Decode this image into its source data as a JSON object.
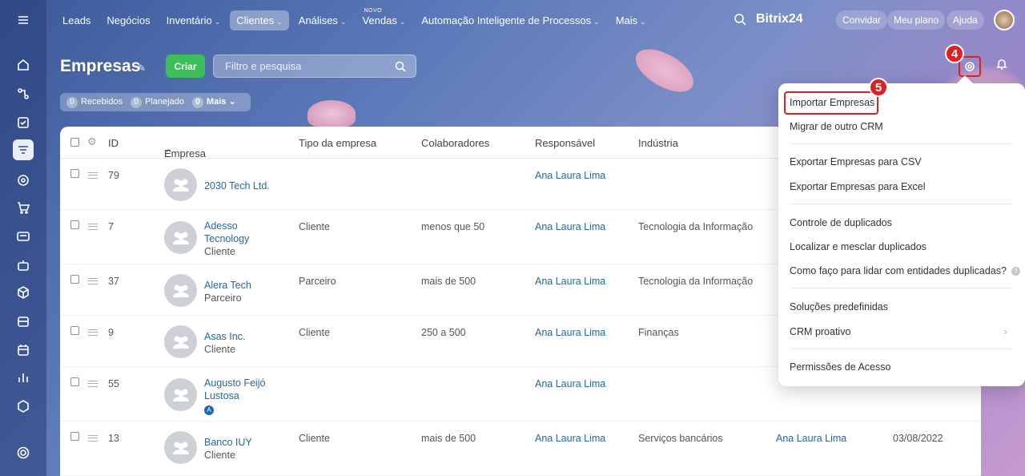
{
  "topnav": {
    "items": [
      "Leads",
      "Negócios",
      "Inventário",
      "Clientes",
      "Análises",
      "Vendas",
      "Automação Inteligente de Processos",
      "Mais"
    ],
    "new_badge": "NOVO",
    "brand": "Bitrix24",
    "invite": "Convidar",
    "plan": "Meu plano",
    "help": "Ajuda"
  },
  "page": {
    "title": "Empresas",
    "create_label": "Criar",
    "filter_placeholder": "Filtro e pesquisa"
  },
  "counters": {
    "received_count": "0",
    "received_label": "Recebidos",
    "planned_count": "0",
    "planned_label": "Planejado",
    "more_count": "0",
    "more_label": "Mais"
  },
  "steps": {
    "gear_step": "4",
    "import_step": "5"
  },
  "table": {
    "headers": [
      "ID",
      "Empresa",
      "Tipo da empresa",
      "Colaboradores",
      "Responsável",
      "Indústria"
    ],
    "rows": [
      {
        "id": "79",
        "name": "2030 Tech Ltd.",
        "subtype": "",
        "type": "",
        "staff": "",
        "owner": "Ana Laura Lima",
        "industry": ""
      },
      {
        "id": "7",
        "name": "Adesso Tecnology",
        "subtype": "Cliente",
        "type": "Cliente",
        "staff": "menos que 50",
        "owner": "Ana Laura Lima",
        "industry": "Tecnologia da Informação"
      },
      {
        "id": "37",
        "name": "Alera Tech",
        "subtype": "Parceiro",
        "type": "Parceiro",
        "staff": "mais de 500",
        "owner": "Ana Laura Lima",
        "industry": "Tecnologia da Informação"
      },
      {
        "id": "9",
        "name": "Asas Inc.",
        "subtype": "Cliente",
        "type": "Cliente",
        "staff": "250 a 500",
        "owner": "Ana Laura Lima",
        "industry": "Finanças"
      },
      {
        "id": "55",
        "name": "Augusto Feijó Lustosa",
        "subtype": "",
        "type": "",
        "staff": "",
        "owner": "Ana Laura Lima",
        "industry": ""
      },
      {
        "id": "13",
        "name": "Banco IUY",
        "subtype": "Cliente",
        "type": "Cliente",
        "staff": "mais de 500",
        "owner": "Ana Laura Lima",
        "industry": "Serviços bancários"
      }
    ],
    "row6_extra_owner": "Ana Laura Lima",
    "row6_date": "03/08/2022"
  },
  "menu": {
    "items": [
      "Importar Empresas",
      "Migrar de outro CRM",
      "Exportar Empresas para CSV",
      "Exportar Empresas para Excel",
      "Controle de duplicados",
      "Localizar e mesclar duplicados",
      "Como faço para lidar com entidades duplicadas?",
      "Soluções predefinidas",
      "CRM proativo",
      "Permissões de Acesso"
    ]
  }
}
